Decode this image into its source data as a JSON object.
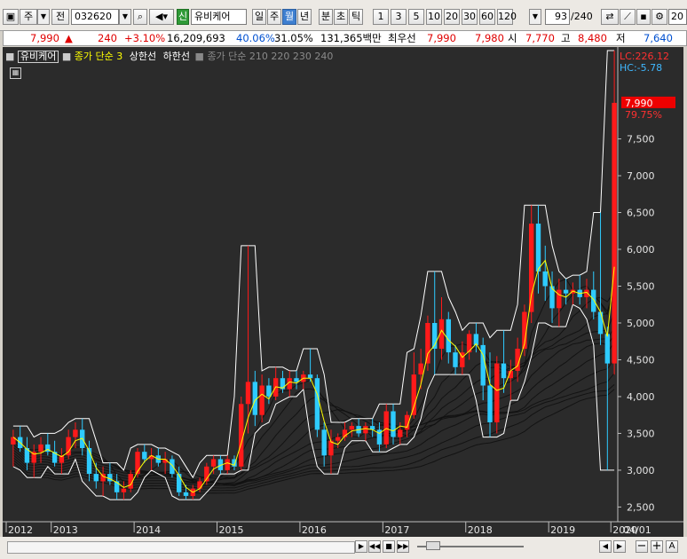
{
  "toolbar": {
    "market_select": "주",
    "market_type": "전",
    "stock_code": "032620",
    "badge": "신",
    "stock_name": "유비케어",
    "period_tabs": [
      "일",
      "주",
      "월",
      "년"
    ],
    "selected_period": "월",
    "minute_tabs": [
      "분",
      "초",
      "틱"
    ],
    "interval_buttons": [
      "1",
      "3",
      "5",
      "10",
      "20",
      "30",
      "60",
      "120"
    ],
    "bar_count": "93",
    "bar_total": "/240",
    "right_field": "20"
  },
  "quote": {
    "price": "7,990",
    "change_arrow": "▲",
    "change": "240",
    "change_pct": "+3.10%",
    "volume": "16,209,693",
    "volume_ratio": "40.06%",
    "turnover": "31.05%",
    "amount": "131,365백만",
    "bid_label": "최우선",
    "ask": "7,990",
    "bid": "7,980",
    "open_label": "시",
    "open": "7,770",
    "high_label": "고",
    "high": "8,480",
    "low_label": "저",
    "low": "7,640"
  },
  "legend": {
    "name": "유비케어",
    "ma_label": "종가 단순 3",
    "upper_label": "상한선",
    "lower_label": "하한선",
    "ma2_label": "종가 단순 210 220 230 240"
  },
  "chart_info": {
    "lc_label": "LC:226.12",
    "hc_label": "HC:-5.78",
    "last_price_label": "7,990",
    "last_pct_label": "79.75%",
    "end_label": "04/01"
  },
  "chart_data": {
    "type": "candlestick",
    "x_labels": [
      "2012",
      "2013",
      "2014",
      "2015",
      "2016",
      "2017",
      "2018",
      "2019",
      "2020"
    ],
    "y_ticks": [
      "2,500",
      "3,000",
      "3,500",
      "4,000",
      "4,500",
      "5,000",
      "5,500",
      "6,000",
      "6,500",
      "7,000",
      "7,500"
    ],
    "ylim": [
      2300,
      8700
    ],
    "colors": {
      "up": "#ff1a1a",
      "down": "#2ecbff",
      "ma": "#ffff00",
      "band": "#ffffff",
      "avg": "#111111",
      "bg": "#2b2b2b"
    },
    "candles": [
      {
        "o": 3350,
        "h": 3550,
        "l": 3050,
        "c": 3450
      },
      {
        "o": 3450,
        "h": 3600,
        "l": 3250,
        "c": 3300
      },
      {
        "o": 3300,
        "h": 3450,
        "l": 3000,
        "c": 3100
      },
      {
        "o": 3100,
        "h": 3350,
        "l": 2900,
        "c": 3250
      },
      {
        "o": 3250,
        "h": 3450,
        "l": 3100,
        "c": 3350
      },
      {
        "o": 3350,
        "h": 3500,
        "l": 3200,
        "c": 3250
      },
      {
        "o": 3250,
        "h": 3400,
        "l": 3050,
        "c": 3100
      },
      {
        "o": 3100,
        "h": 3300,
        "l": 2950,
        "c": 3200
      },
      {
        "o": 3200,
        "h": 3550,
        "l": 3150,
        "c": 3450
      },
      {
        "o": 3450,
        "h": 3650,
        "l": 3300,
        "c": 3550
      },
      {
        "o": 3550,
        "h": 3700,
        "l": 3200,
        "c": 3300
      },
      {
        "o": 3300,
        "h": 3400,
        "l": 2850,
        "c": 2950
      },
      {
        "o": 2950,
        "h": 3100,
        "l": 2750,
        "c": 2850
      },
      {
        "o": 2850,
        "h": 3050,
        "l": 2650,
        "c": 2950
      },
      {
        "o": 2950,
        "h": 3100,
        "l": 2800,
        "c": 2850
      },
      {
        "o": 2850,
        "h": 2950,
        "l": 2600,
        "c": 2700
      },
      {
        "o": 2700,
        "h": 2850,
        "l": 2600,
        "c": 2750
      },
      {
        "o": 2750,
        "h": 3000,
        "l": 2700,
        "c": 2950
      },
      {
        "o": 2950,
        "h": 3300,
        "l": 2900,
        "c": 3250
      },
      {
        "o": 3250,
        "h": 3350,
        "l": 3100,
        "c": 3150
      },
      {
        "o": 3150,
        "h": 3300,
        "l": 3000,
        "c": 3200
      },
      {
        "o": 3200,
        "h": 3300,
        "l": 3050,
        "c": 3100
      },
      {
        "o": 3100,
        "h": 3250,
        "l": 2950,
        "c": 3150
      },
      {
        "o": 3150,
        "h": 3200,
        "l": 2900,
        "c": 2950
      },
      {
        "o": 2950,
        "h": 3050,
        "l": 2650,
        "c": 2700
      },
      {
        "o": 2700,
        "h": 2800,
        "l": 2600,
        "c": 2650
      },
      {
        "o": 2650,
        "h": 2800,
        "l": 2600,
        "c": 2750
      },
      {
        "o": 2750,
        "h": 2900,
        "l": 2700,
        "c": 2850
      },
      {
        "o": 2850,
        "h": 3100,
        "l": 2800,
        "c": 3050
      },
      {
        "o": 3050,
        "h": 3200,
        "l": 2950,
        "c": 3150
      },
      {
        "o": 3150,
        "h": 3200,
        "l": 2950,
        "c": 3000
      },
      {
        "o": 3000,
        "h": 3200,
        "l": 2950,
        "c": 3150
      },
      {
        "o": 3150,
        "h": 3200,
        "l": 3000,
        "c": 3050
      },
      {
        "o": 3050,
        "h": 4000,
        "l": 3000,
        "c": 3900
      },
      {
        "o": 3900,
        "h": 6050,
        "l": 3500,
        "c": 4200
      },
      {
        "o": 4200,
        "h": 4350,
        "l": 3600,
        "c": 3750
      },
      {
        "o": 3750,
        "h": 4300,
        "l": 3650,
        "c": 4150
      },
      {
        "o": 4150,
        "h": 4250,
        "l": 3900,
        "c": 4000
      },
      {
        "o": 4000,
        "h": 4400,
        "l": 3950,
        "c": 4250
      },
      {
        "o": 4250,
        "h": 4350,
        "l": 4050,
        "c": 4100
      },
      {
        "o": 4100,
        "h": 4350,
        "l": 4000,
        "c": 4250
      },
      {
        "o": 4250,
        "h": 4350,
        "l": 4100,
        "c": 4200
      },
      {
        "o": 4200,
        "h": 4350,
        "l": 4100,
        "c": 4300
      },
      {
        "o": 4300,
        "h": 4650,
        "l": 4200,
        "c": 4250
      },
      {
        "o": 4250,
        "h": 4300,
        "l": 3450,
        "c": 3550
      },
      {
        "o": 3550,
        "h": 3650,
        "l": 3050,
        "c": 3200
      },
      {
        "o": 3200,
        "h": 3550,
        "l": 2950,
        "c": 3400
      },
      {
        "o": 3400,
        "h": 3500,
        "l": 3300,
        "c": 3450
      },
      {
        "o": 3450,
        "h": 3650,
        "l": 3400,
        "c": 3550
      },
      {
        "o": 3550,
        "h": 3650,
        "l": 3450,
        "c": 3600
      },
      {
        "o": 3600,
        "h": 3700,
        "l": 3450,
        "c": 3500
      },
      {
        "o": 3500,
        "h": 3650,
        "l": 3400,
        "c": 3600
      },
      {
        "o": 3600,
        "h": 3700,
        "l": 3450,
        "c": 3550
      },
      {
        "o": 3550,
        "h": 3650,
        "l": 3250,
        "c": 3350
      },
      {
        "o": 3350,
        "h": 3900,
        "l": 3300,
        "c": 3800
      },
      {
        "o": 3800,
        "h": 3900,
        "l": 3350,
        "c": 3450
      },
      {
        "o": 3450,
        "h": 3650,
        "l": 3350,
        "c": 3550
      },
      {
        "o": 3550,
        "h": 3800,
        "l": 3450,
        "c": 3750
      },
      {
        "o": 3750,
        "h": 4600,
        "l": 3700,
        "c": 4300
      },
      {
        "o": 4300,
        "h": 4650,
        "l": 4100,
        "c": 4450
      },
      {
        "o": 4450,
        "h": 5100,
        "l": 4350,
        "c": 5000
      },
      {
        "o": 5000,
        "h": 5700,
        "l": 4300,
        "c": 4650
      },
      {
        "o": 4650,
        "h": 5350,
        "l": 4500,
        "c": 5050
      },
      {
        "o": 5050,
        "h": 5150,
        "l": 4450,
        "c": 4600
      },
      {
        "o": 4600,
        "h": 4700,
        "l": 4300,
        "c": 4400
      },
      {
        "o": 4400,
        "h": 4750,
        "l": 4300,
        "c": 4600
      },
      {
        "o": 4600,
        "h": 4900,
        "l": 4500,
        "c": 4850
      },
      {
        "o": 4850,
        "h": 5000,
        "l": 4600,
        "c": 4700
      },
      {
        "o": 4700,
        "h": 4800,
        "l": 3950,
        "c": 4150
      },
      {
        "o": 4150,
        "h": 4600,
        "l": 3450,
        "c": 3650
      },
      {
        "o": 3650,
        "h": 4550,
        "l": 3500,
        "c": 4450
      },
      {
        "o": 4450,
        "h": 4900,
        "l": 4050,
        "c": 4250
      },
      {
        "o": 4250,
        "h": 4500,
        "l": 3950,
        "c": 4350
      },
      {
        "o": 4350,
        "h": 4800,
        "l": 4200,
        "c": 4650
      },
      {
        "o": 4650,
        "h": 5250,
        "l": 4550,
        "c": 5150
      },
      {
        "o": 5150,
        "h": 6600,
        "l": 5000,
        "c": 6350
      },
      {
        "o": 6350,
        "h": 6600,
        "l": 5400,
        "c": 5700
      },
      {
        "o": 5700,
        "h": 6050,
        "l": 5300,
        "c": 5500
      },
      {
        "o": 5500,
        "h": 5700,
        "l": 5000,
        "c": 5200
      },
      {
        "o": 5200,
        "h": 5600,
        "l": 4950,
        "c": 5450
      },
      {
        "o": 5450,
        "h": 5600,
        "l": 5250,
        "c": 5400
      },
      {
        "o": 5400,
        "h": 5550,
        "l": 5250,
        "c": 5450
      },
      {
        "o": 5450,
        "h": 5650,
        "l": 5250,
        "c": 5350
      },
      {
        "o": 5350,
        "h": 5600,
        "l": 5200,
        "c": 5450
      },
      {
        "o": 5450,
        "h": 5700,
        "l": 5050,
        "c": 5150
      },
      {
        "o": 5150,
        "h": 6500,
        "l": 4700,
        "c": 4850
      },
      {
        "o": 4850,
        "h": 4950,
        "l": 3000,
        "c": 4450
      },
      {
        "o": 4450,
        "h": 8700,
        "l": 4300,
        "c": 7990
      }
    ]
  }
}
